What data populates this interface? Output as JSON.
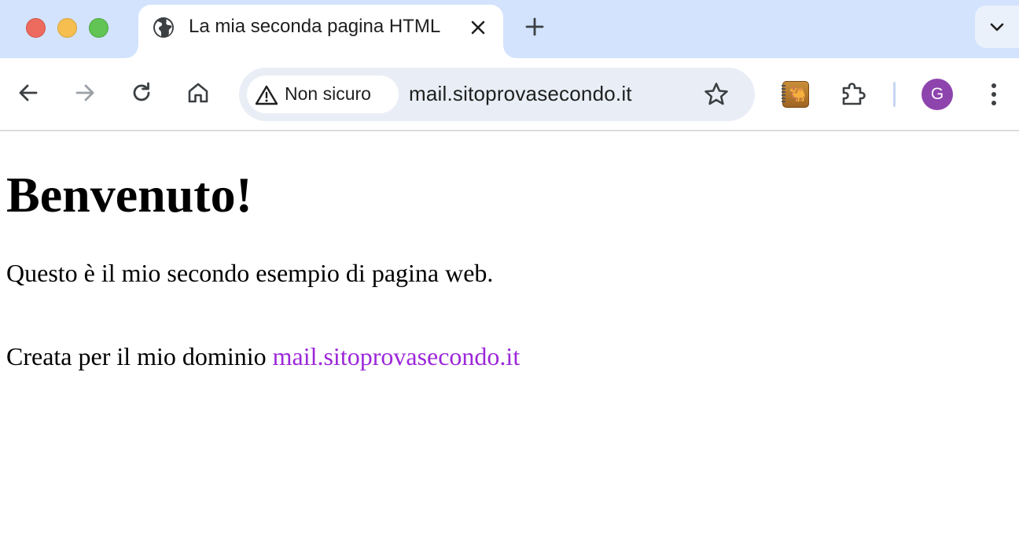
{
  "window": {
    "traffic_lights": [
      "close",
      "minimize",
      "zoom"
    ]
  },
  "tab": {
    "title": "La mia seconda pagina HTML",
    "favicon": "globe-icon",
    "close_icon": "close-icon"
  },
  "toolbar": {
    "security_label": "Non sicuro",
    "url": "mail.sitoprovasecondo.it",
    "profile_initial": "G"
  },
  "page": {
    "heading": "Benvenuto!",
    "paragraph1": "Questo è il mio secondo esempio di pagina web.",
    "paragraph2_prefix": "Creata per il mio dominio ",
    "link_text": "mail.sitoprovasecondo.it"
  },
  "colors": {
    "tabstrip_bg": "#d3e3fd",
    "omnibox_bg": "#e9eef6",
    "link": "#9c27d9",
    "avatar": "#8e44ad"
  }
}
